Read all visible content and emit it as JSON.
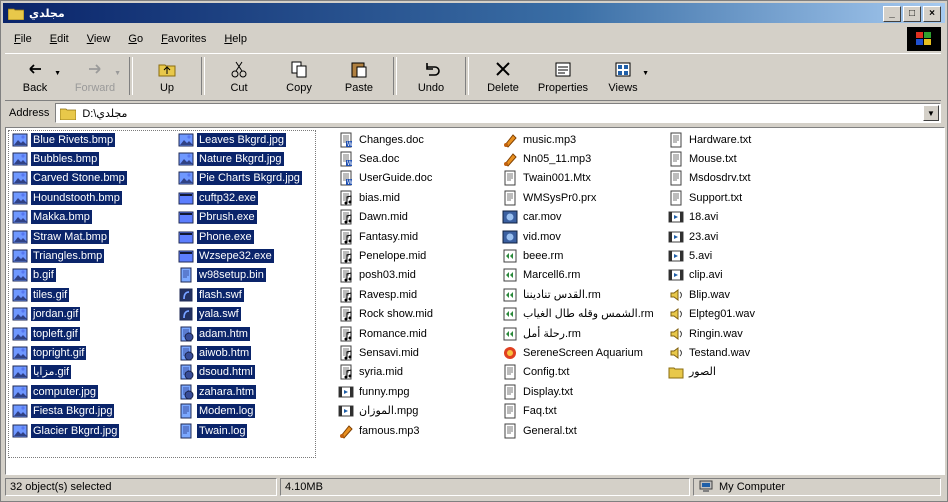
{
  "window": {
    "title": "مجلدي"
  },
  "title_buttons": [
    "_",
    "□",
    "×"
  ],
  "menu": [
    "File",
    "Edit",
    "View",
    "Go",
    "Favorites",
    "Help"
  ],
  "toolbar": [
    {
      "label": "Back",
      "icon": "back-arrow-icon",
      "disabled": false,
      "dropdown": true
    },
    {
      "label": "Forward",
      "icon": "forward-arrow-icon",
      "disabled": true,
      "dropdown": true
    },
    {
      "label": "Up",
      "icon": "up-folder-icon",
      "disabled": false,
      "dropdown": false
    },
    {
      "label": "Cut",
      "icon": "scissors-icon",
      "disabled": false,
      "dropdown": false
    },
    {
      "label": "Copy",
      "icon": "copy-icon",
      "disabled": false,
      "dropdown": false
    },
    {
      "label": "Paste",
      "icon": "paste-icon",
      "disabled": false,
      "dropdown": false
    },
    {
      "label": "Undo",
      "icon": "undo-icon",
      "disabled": false,
      "dropdown": false
    },
    {
      "label": "Delete",
      "icon": "delete-x-icon",
      "disabled": false,
      "dropdown": false
    },
    {
      "label": "Properties",
      "icon": "properties-icon",
      "disabled": false,
      "dropdown": false
    },
    {
      "label": "Views",
      "icon": "views-icon",
      "disabled": false,
      "dropdown": true
    }
  ],
  "address": {
    "label": "Address",
    "value": "D:\\مجلدي"
  },
  "columns": [
    [
      {
        "name": "Blue Rivets.bmp",
        "type": "bmp",
        "selected": true
      },
      {
        "name": "Bubbles.bmp",
        "type": "bmp",
        "selected": true
      },
      {
        "name": "Carved Stone.bmp",
        "type": "bmp",
        "selected": true
      },
      {
        "name": "Houndstooth.bmp",
        "type": "bmp",
        "selected": true
      },
      {
        "name": "Makka.bmp",
        "type": "bmp",
        "selected": true
      },
      {
        "name": "Straw Mat.bmp",
        "type": "bmp",
        "selected": true
      },
      {
        "name": "Triangles.bmp",
        "type": "bmp",
        "selected": true
      },
      {
        "name": "b.gif",
        "type": "gif",
        "selected": true
      },
      {
        "name": "tiles.gif",
        "type": "gif",
        "selected": true
      },
      {
        "name": "jordan.gif",
        "type": "gif",
        "selected": true
      },
      {
        "name": "topleft.gif",
        "type": "gif",
        "selected": true
      },
      {
        "name": "topright.gif",
        "type": "gif",
        "selected": true
      },
      {
        "name": "مزايا.gif",
        "type": "gif",
        "selected": true
      },
      {
        "name": "computer.jpg",
        "type": "jpg",
        "selected": true
      },
      {
        "name": "Fiesta Bkgrd.jpg",
        "type": "jpg",
        "selected": true
      },
      {
        "name": "Glacier Bkgrd.jpg",
        "type": "jpg",
        "selected": true
      }
    ],
    [
      {
        "name": "Leaves Bkgrd.jpg",
        "type": "jpg",
        "selected": true
      },
      {
        "name": "Nature Bkgrd.jpg",
        "type": "jpg",
        "selected": true
      },
      {
        "name": "Pie Charts Bkgrd.jpg",
        "type": "jpg",
        "selected": true
      },
      {
        "name": "cuftp32.exe",
        "type": "exe",
        "selected": true
      },
      {
        "name": "Pbrush.exe",
        "type": "exe",
        "selected": true
      },
      {
        "name": "Phone.exe",
        "type": "exe",
        "selected": true
      },
      {
        "name": "Wzsepe32.exe",
        "type": "exe",
        "selected": true
      },
      {
        "name": "w98setup.bin",
        "type": "bin",
        "selected": true
      },
      {
        "name": "flash.swf",
        "type": "swf",
        "selected": true
      },
      {
        "name": "yala.swf",
        "type": "swf",
        "selected": true
      },
      {
        "name": "adam.htm",
        "type": "htm",
        "selected": true
      },
      {
        "name": "aiwob.htm",
        "type": "htm",
        "selected": true
      },
      {
        "name": "dsoud.html",
        "type": "htm",
        "selected": true
      },
      {
        "name": "zahara.htm",
        "type": "htm",
        "selected": true
      },
      {
        "name": "Modem.log",
        "type": "log",
        "selected": true
      },
      {
        "name": "Twain.log",
        "type": "log",
        "selected": true
      }
    ],
    [
      {
        "name": "Changes.doc",
        "type": "doc",
        "selected": false
      },
      {
        "name": "Sea.doc",
        "type": "doc",
        "selected": false
      },
      {
        "name": "UserGuide.doc",
        "type": "doc",
        "selected": false
      },
      {
        "name": "bias.mid",
        "type": "mid",
        "selected": false
      },
      {
        "name": "Dawn.mid",
        "type": "mid",
        "selected": false
      },
      {
        "name": "Fantasy.mid",
        "type": "mid",
        "selected": false
      },
      {
        "name": "Penelope.mid",
        "type": "mid",
        "selected": false
      },
      {
        "name": "posh03.mid",
        "type": "mid",
        "selected": false
      },
      {
        "name": "Ravesp.mid",
        "type": "mid",
        "selected": false
      },
      {
        "name": "Rock show.mid",
        "type": "mid",
        "selected": false
      },
      {
        "name": "Romance.mid",
        "type": "mid",
        "selected": false
      },
      {
        "name": "Sensavi.mid",
        "type": "mid",
        "selected": false
      },
      {
        "name": "syria.mid",
        "type": "mid",
        "selected": false
      },
      {
        "name": "funny.mpg",
        "type": "mpg",
        "selected": false
      },
      {
        "name": "الموزان.mpg",
        "type": "mpg",
        "selected": false
      },
      {
        "name": "famous.mp3",
        "type": "mp3",
        "selected": false
      }
    ],
    [
      {
        "name": "music.mp3",
        "type": "mp3",
        "selected": false
      },
      {
        "name": "Nn05_11.mp3",
        "type": "mp3",
        "selected": false
      },
      {
        "name": "Twain001.Mtx",
        "type": "mtx",
        "selected": false
      },
      {
        "name": "WMSysPr0.prx",
        "type": "prx",
        "selected": false
      },
      {
        "name": "car.mov",
        "type": "mov",
        "selected": false
      },
      {
        "name": "vid.mov",
        "type": "mov",
        "selected": false
      },
      {
        "name": "beee.rm",
        "type": "rm",
        "selected": false
      },
      {
        "name": "Marcell6.rm",
        "type": "rm",
        "selected": false
      },
      {
        "name": "القدس تناديننا.rm",
        "type": "rm",
        "selected": false
      },
      {
        "name": "الشمس وقله طال الغياب.rm",
        "type": "rm",
        "selected": false
      },
      {
        "name": "رحلة أمل.rm",
        "type": "rm",
        "selected": false
      },
      {
        "name": "SereneScreen Aquarium",
        "type": "scr",
        "selected": false
      },
      {
        "name": "Config.txt",
        "type": "txt",
        "selected": false
      },
      {
        "name": "Display.txt",
        "type": "txt",
        "selected": false
      },
      {
        "name": "Faq.txt",
        "type": "txt",
        "selected": false
      },
      {
        "name": "General.txt",
        "type": "txt",
        "selected": false
      }
    ],
    [
      {
        "name": "Hardware.txt",
        "type": "txt",
        "selected": false
      },
      {
        "name": "Mouse.txt",
        "type": "txt",
        "selected": false
      },
      {
        "name": "Msdosdrv.txt",
        "type": "txt",
        "selected": false
      },
      {
        "name": "Support.txt",
        "type": "txt",
        "selected": false
      },
      {
        "name": "18.avi",
        "type": "avi",
        "selected": false
      },
      {
        "name": "23.avi",
        "type": "avi",
        "selected": false
      },
      {
        "name": "5.avi",
        "type": "avi",
        "selected": false
      },
      {
        "name": "clip.avi",
        "type": "avi",
        "selected": false
      },
      {
        "name": "Blip.wav",
        "type": "wav",
        "selected": false
      },
      {
        "name": "Elpteg01.wav",
        "type": "wav",
        "selected": false
      },
      {
        "name": "Ringin.wav",
        "type": "wav",
        "selected": false
      },
      {
        "name": "Testand.wav",
        "type": "wav",
        "selected": false
      },
      {
        "name": "الصور",
        "type": "folder",
        "selected": false
      }
    ]
  ],
  "status": {
    "selection": "32 object(s) selected",
    "size": "4.10MB",
    "zone": "My Computer"
  },
  "colors": {
    "selection": "#0a246a",
    "titlebar_start": "#0a246a",
    "titlebar_end": "#a6caf0",
    "face": "#d4d0c8"
  }
}
